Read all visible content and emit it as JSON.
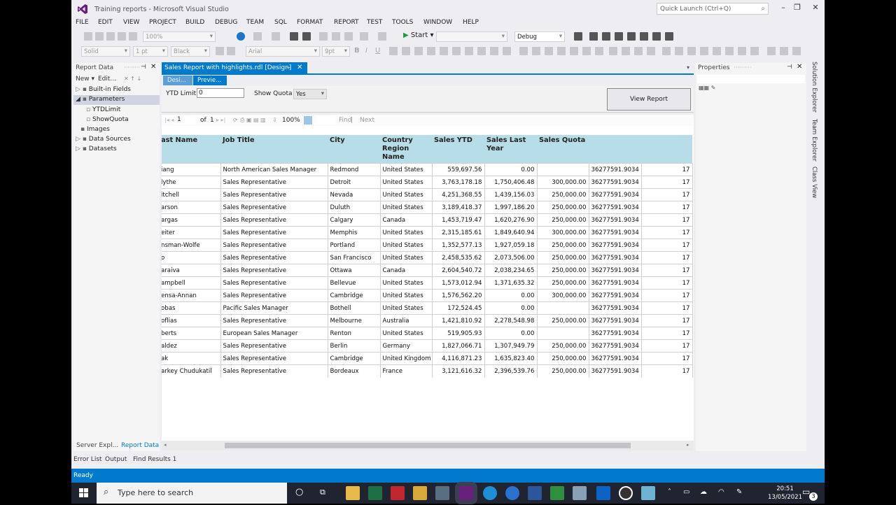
{
  "window": {
    "title": "Training reports - Microsoft Visual Studio",
    "quick_launch": "Quick Launch (Ctrl+Q)"
  },
  "menu": [
    "FILE",
    "EDIT",
    "VIEW",
    "PROJECT",
    "BUILD",
    "DEBUG",
    "TEAM",
    "SQL",
    "FORMAT",
    "REPORT",
    "TEST",
    "TOOLS",
    "WINDOW",
    "HELP"
  ],
  "toolbar": {
    "zoom": "100%",
    "start_label": "Start",
    "config": "Debug",
    "border_style": "Solid",
    "border_width": "1 pt",
    "border_color": "Black",
    "font": "Arial",
    "font_size": "9pt"
  },
  "left_panel": {
    "title": "Report Data",
    "new_label": "New",
    "edit_label": "Edit...",
    "tree": [
      {
        "label": "Built-in Fields",
        "level": 0
      },
      {
        "label": "Parameters",
        "level": 0,
        "selected": true
      },
      {
        "label": "YTDLimit",
        "level": 1
      },
      {
        "label": "ShowQuota",
        "level": 1
      },
      {
        "label": "Images",
        "level": 0
      },
      {
        "label": "Data Sources",
        "level": 0
      },
      {
        "label": "Datasets",
        "level": 0
      }
    ],
    "bottom_tabs": [
      "Server Expl...",
      "Report Data"
    ]
  },
  "document": {
    "tab_label": "Sales Report with highlights.rdl [Design]",
    "subtab_design": "Desi...",
    "subtab_preview": "Previe...",
    "param_ytd_label": "YTD Limit",
    "param_ytd_value": "0",
    "param_quota_label": "Show Quota",
    "param_quota_value": "Yes",
    "view_report_label": "View Report",
    "page_current": "1",
    "page_of": "of",
    "page_total": "1",
    "zoom": "100%",
    "find_label": "Find",
    "next_label": "Next"
  },
  "report": {
    "headers": [
      "ast Name",
      "Job Title",
      "City",
      "Country Region Name",
      "Sales YTD",
      "Sales Last Year",
      "Sales Quota",
      "",
      ""
    ],
    "rows": [
      [
        "iang",
        "North American Sales Manager",
        "Redmond",
        "United States",
        "559,697.56",
        "0.00",
        "",
        "36277591.9034",
        "17"
      ],
      [
        "lythe",
        "Sales Representative",
        "Detroit",
        "United States",
        "3,763,178.18",
        "1,750,406.48",
        "300,000.00",
        "36277591.9034",
        "17"
      ],
      [
        "itchell",
        "Sales Representative",
        "Nevada",
        "United States",
        "4,251,368.55",
        "1,439,156.03",
        "250,000.00",
        "36277591.9034",
        "17"
      ],
      [
        "arson",
        "Sales Representative",
        "Duluth",
        "United States",
        "3,189,418.37",
        "1,997,186.20",
        "250,000.00",
        "36277591.9034",
        "17"
      ],
      [
        "argas",
        "Sales Representative",
        "Calgary",
        "Canada",
        "1,453,719.47",
        "1,620,276.90",
        "250,000.00",
        "36277591.9034",
        "17"
      ],
      [
        "eiter",
        "Sales Representative",
        "Memphis",
        "United States",
        "2,315,185.61",
        "1,849,640.94",
        "300,000.00",
        "36277591.9034",
        "17"
      ],
      [
        "nsman-Wolfe",
        "Sales Representative",
        "Portland",
        "United States",
        "1,352,577.13",
        "1,927,059.18",
        "250,000.00",
        "36277591.9034",
        "17"
      ],
      [
        "o",
        "Sales Representative",
        "San Francisco",
        "United States",
        "2,458,535.62",
        "2,073,506.00",
        "250,000.00",
        "36277591.9034",
        "17"
      ],
      [
        "araiva",
        "Sales Representative",
        "Ottawa",
        "Canada",
        "2,604,540.72",
        "2,038,234.65",
        "250,000.00",
        "36277591.9034",
        "17"
      ],
      [
        "ampbell",
        "Sales Representative",
        "Bellevue",
        "United States",
        "1,573,012.94",
        "1,371,635.32",
        "250,000.00",
        "36277591.9034",
        "17"
      ],
      [
        "ensa-Annan",
        "Sales Representative",
        "Cambridge",
        "United States",
        "1,576,562.20",
        "0.00",
        "300,000.00",
        "36277591.9034",
        "17"
      ],
      [
        "obas",
        "Pacific Sales Manager",
        "Bothell",
        "United States",
        "172,524.45",
        "0.00",
        "",
        "36277591.9034",
        "17"
      ],
      [
        "oflias",
        "Sales Representative",
        "Melbourne",
        "Australia",
        "1,421,810.92",
        "2,278,548.98",
        "250,000.00",
        "36277591.9034",
        "17"
      ],
      [
        "berts",
        "European Sales Manager",
        "Renton",
        "United States",
        "519,905.93",
        "0.00",
        "",
        "36277591.9034",
        "17"
      ],
      [
        "aldez",
        "Sales Representative",
        "Berlin",
        "Germany",
        "1,827,066.71",
        "1,307,949.79",
        "250,000.00",
        "36277591.9034",
        "17"
      ],
      [
        "ak",
        "Sales Representative",
        "Cambridge",
        "United Kingdom",
        "4,116,871.23",
        "1,635,823.40",
        "250,000.00",
        "36277591.9034",
        "17"
      ],
      [
        "arkey Chudukatil",
        "Sales Representative",
        "Bordeaux",
        "France",
        "3,121,616.32",
        "2,396,539.76",
        "250,000.00",
        "36277591.9034",
        "17"
      ]
    ]
  },
  "properties": {
    "title": "Properties"
  },
  "side_tabs": [
    "Solution Explorer",
    "Team Explorer",
    "Class View"
  ],
  "bottom_tabs": [
    "Error List",
    "Output",
    "Find Results 1"
  ],
  "status": "Ready",
  "taskbar": {
    "search_placeholder": "Type here to search",
    "time": "20:51",
    "date": "13/05/2021",
    "notif_count": "3"
  },
  "colors": {
    "accent": "#007acc",
    "header_fill": "#b7dee8"
  }
}
